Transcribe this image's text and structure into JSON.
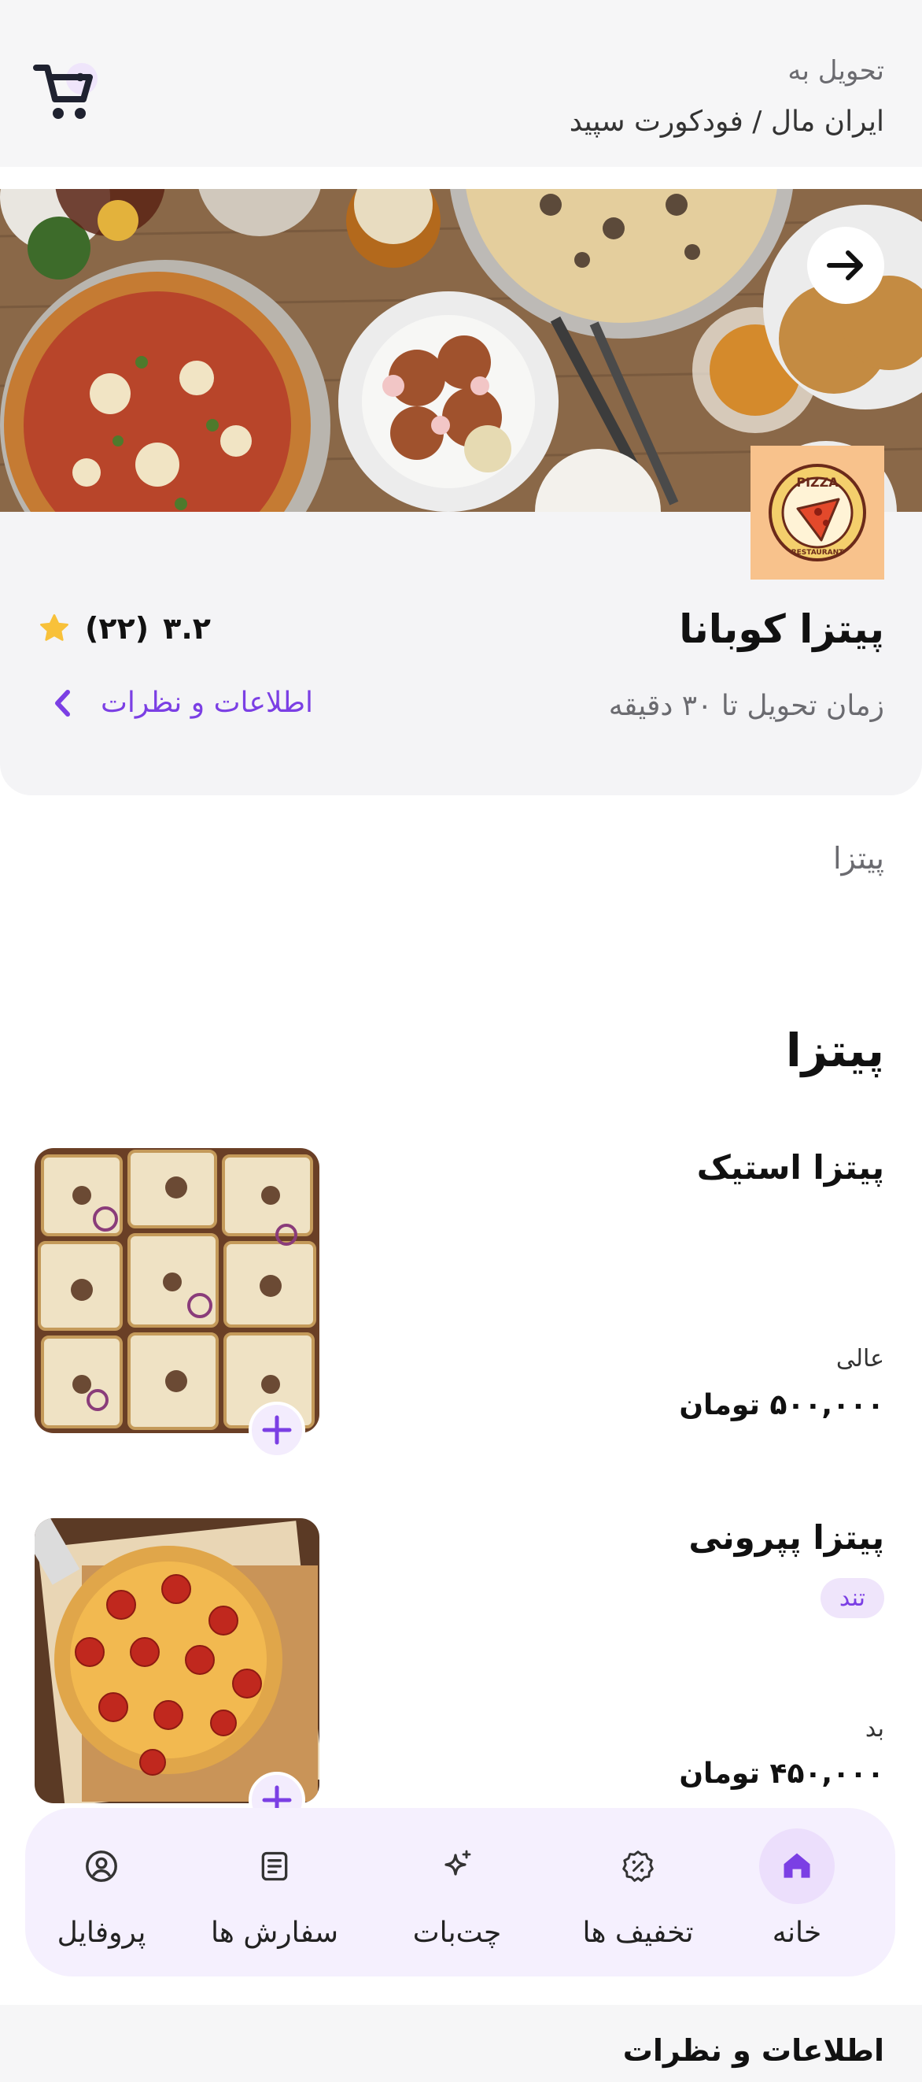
{
  "header": {
    "deliver_label": "تحویل به",
    "address": "ایران مال / فودکورت سپید"
  },
  "restaurant": {
    "name": "پیتزا کوبانا",
    "rating": "۳.۲",
    "rating_count": "(۲۲)",
    "delivery_time": "زمان تحویل تا ۳۰ دقیقه",
    "info_link": "اطلاعات و نظرات",
    "logo_text_top": "PIZZA",
    "logo_text_bottom": "RESTAURANT"
  },
  "category_tab": "پیتزا",
  "section_title": "پیتزا",
  "items": [
    {
      "name": "پیتزا استیک",
      "tag": "",
      "description": "عالی",
      "price": "۵۰۰,۰۰۰ تومان"
    },
    {
      "name": "پیتزا پپرونی",
      "tag": "تند",
      "description": "بد",
      "price": "۴۵۰,۰۰۰ تومان"
    }
  ],
  "nav": [
    {
      "label": "خانه",
      "icon": "home-icon",
      "active": true
    },
    {
      "label": "تخفیف ها",
      "icon": "discount-icon",
      "active": false
    },
    {
      "label": "چت‌بات",
      "icon": "sparkle-icon",
      "active": false
    },
    {
      "label": "سفارش ها",
      "icon": "orders-icon",
      "active": false
    },
    {
      "label": "پروفایل",
      "icon": "profile-icon",
      "active": false
    }
  ],
  "bottom_title": "اطلاعات و نظرات",
  "colors": {
    "accent": "#7b3fe4",
    "star": "#f8c13a",
    "panel": "#f4f4f6",
    "nav_bg": "#f5f0fe"
  }
}
